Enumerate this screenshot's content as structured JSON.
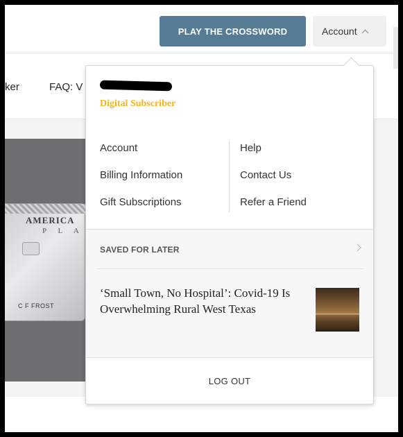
{
  "header": {
    "crossword_label": "PLAY THE CROSSWORD",
    "account_label": "Account"
  },
  "nav": {
    "items": [
      "ker",
      "FAQ: V"
    ]
  },
  "promo": {
    "card_brand": "AMERICA",
    "card_subtitle": "P L A",
    "card_name": "C F FROST"
  },
  "account_menu": {
    "subscription_label": "Digital Subscriber",
    "left_links": [
      "Account",
      "Billing Information",
      "Gift Subscriptions"
    ],
    "right_links": [
      "Help",
      "Contact Us",
      "Refer a Friend"
    ],
    "saved_label": "SAVED FOR LATER",
    "saved_article": {
      "title": "‘Small Town, No Hospital’: Covid-19 Is Overwhelming Rural West Texas"
    },
    "logout_label": "LOG OUT"
  },
  "colors": {
    "crossword_button": "#567b95",
    "subscriber_label": "#f3b51b"
  }
}
